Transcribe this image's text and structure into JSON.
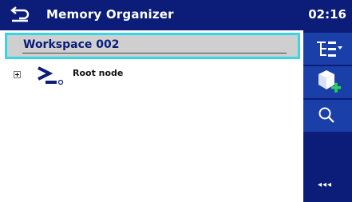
{
  "header": {
    "title": "Memory Organizer",
    "time": "02:16",
    "back_icon": "back-arrow-icon"
  },
  "workspace": {
    "name": "Workspace 002"
  },
  "tree": {
    "root": {
      "label": "Root node",
      "expanded": false,
      "icon": "root-node-icon"
    }
  },
  "sidebar": {
    "buttons": [
      {
        "icon": "tree-options-icon"
      },
      {
        "icon": "add-structure-icon"
      },
      {
        "icon": "search-icon"
      }
    ],
    "more_label": "◂◂◂"
  },
  "colors": {
    "header_bg": "#0b1d78",
    "sidebar_button": "#1b3fa8",
    "selection_border": "#35d6e6",
    "accent_green": "#2bd15e"
  }
}
